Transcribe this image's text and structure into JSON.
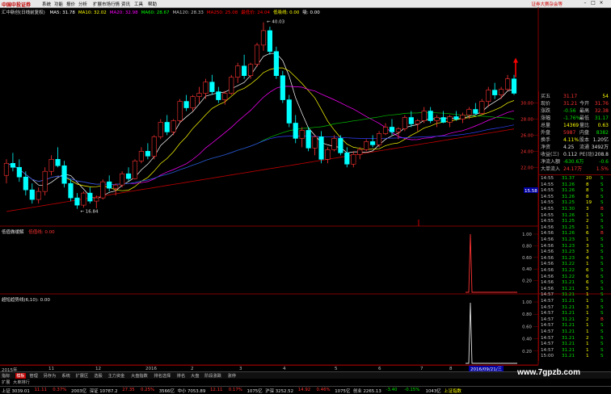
{
  "menubar": {
    "logo": "中国中投证券",
    "items": [
      "系统",
      "功能",
      "报价",
      "分析",
      "扩展市场行情",
      "资讯",
      "工具",
      "帮助"
    ],
    "promo": "证券大赛杂会等"
  },
  "main_chart": {
    "title_prefix": "汇中新创(日线前复权)",
    "indicators": [
      {
        "text": "MA5: 31.78",
        "color": "#ffffff"
      },
      {
        "text": "MA10: 32.02",
        "color": "#ffff00"
      },
      {
        "text": "MA20: 32.98",
        "color": "#ff00ff"
      },
      {
        "text": "MA60: 28.67",
        "color": "#00ff00"
      },
      {
        "text": "MA120: 28.33",
        "color": "#c0c0c0"
      },
      {
        "text": "MA250: 25.08",
        "color": "#ff0000"
      },
      {
        "text": "最低价: 24.04",
        "color": "#ff0000"
      },
      {
        "text": "低吸线: 0.00",
        "color": "#ffff00"
      },
      {
        "text": "吸: 0.00",
        "color": "#ffffff"
      }
    ],
    "y_labels": [
      "30.00",
      "28.00",
      "26.00",
      "24.00",
      "22.00"
    ],
    "high_label": "40.03",
    "low_label": "16.84",
    "cursor_label": "15.58"
  },
  "sub1": {
    "title": "低值做缓解",
    "value": "低值线: 0.00",
    "y_labels": [
      "1.00",
      "0.80",
      "0.60",
      "0.40",
      "0.20"
    ]
  },
  "sub2": {
    "title": "超短趋势线(6,10): 0.00",
    "y_labels": [
      "1.00",
      "0.80",
      "0.60",
      "0.40",
      "0.20"
    ]
  },
  "quote": {
    "rows": [
      {
        "l": "买五",
        "v": "31.17",
        "r": "54",
        "lc": "#c0c0c0",
        "vc": "#ff3232",
        "rc": "#ffff00"
      },
      {
        "l": "现价",
        "v": "31.21",
        "r2l": "今开",
        "r": "31.76",
        "vc": "#ff3232",
        "rc": "#ff3232"
      },
      {
        "l": "涨跌",
        "v": "-0.56",
        "r2l": "最高",
        "r": "32.38",
        "vc": "#00e000",
        "rc": "#ff3232"
      },
      {
        "l": "涨幅",
        "v": "-1.76%",
        "r2l": "最低",
        "r": "31.17",
        "vc": "#00e000",
        "rc": "#00e000"
      },
      {
        "l": "总量",
        "v": "14369",
        "r2l": "量比",
        "r": "0.63",
        "vc": "#ffff00",
        "rc": "#ffff00"
      },
      {
        "l": "外盘",
        "v": "5987",
        "r2l": "内盘",
        "r": "8382",
        "vc": "#ff3232",
        "rc": "#00e000"
      },
      {
        "l": "换手",
        "v": "4.11%",
        "r2l": "股本",
        "r": "1.20亿",
        "vc": "#ffff00",
        "rc": "#e0e0e0"
      },
      {
        "l": "净资",
        "v": "4.25",
        "r2l": "流通",
        "r": "3492万",
        "vc": "#e0e0e0",
        "rc": "#e0e0e0"
      },
      {
        "l": "收益(三)",
        "v": "0.112",
        "r2l": "PE(动)",
        "r": "208.8",
        "vc": "#e0e0e0",
        "rc": "#e0e0e0"
      },
      {
        "l": "净流入额",
        "v": "-630.6万",
        "r": "-0.6",
        "vc": "#00e000",
        "rc": "#00e000"
      },
      {
        "l": "大单流入",
        "v": "24.17万",
        "r": "1.5%",
        "vc": "#ff3232",
        "rc": "#ff3232"
      }
    ],
    "ticks": [
      {
        "t": "14:55",
        "p": "31.37",
        "v": "20",
        "s": "S"
      },
      {
        "t": "14:55",
        "p": "31.26",
        "v": "8",
        "s": "S"
      },
      {
        "t": "14:55",
        "p": "31.26",
        "v": "8",
        "s": "S"
      },
      {
        "t": "14:55",
        "p": "31.26",
        "v": "8",
        "s": "S"
      },
      {
        "t": "14:55",
        "p": "31.25",
        "v": "19",
        "s": "S"
      },
      {
        "t": "14:55",
        "p": "31.30",
        "v": "3",
        "s": "B"
      },
      {
        "t": "14:55",
        "p": "31.26",
        "v": "1",
        "s": "S"
      },
      {
        "t": "14:55",
        "p": "31.25",
        "v": "2",
        "s": "S"
      },
      {
        "t": "14:56",
        "p": "31.25",
        "v": "1",
        "s": "S"
      },
      {
        "t": "14:56",
        "p": "31.26",
        "v": "6",
        "s": "B"
      },
      {
        "t": "14:56",
        "p": "31.23",
        "v": "1",
        "s": "S"
      },
      {
        "t": "14:56",
        "p": "31.23",
        "v": "3",
        "s": "S"
      },
      {
        "t": "14:56",
        "p": "31.23",
        "v": "3",
        "s": "S"
      },
      {
        "t": "14:56",
        "p": "31.23",
        "v": "4",
        "s": "S"
      },
      {
        "t": "14:56",
        "p": "31.22",
        "v": "1",
        "s": "S"
      },
      {
        "t": "14:56",
        "p": "31.22",
        "v": "6",
        "s": "S"
      },
      {
        "t": "14:56",
        "p": "31.22",
        "v": "6",
        "s": "S"
      },
      {
        "t": "14:56",
        "p": "31.21",
        "v": "6",
        "s": "S"
      },
      {
        "t": "14:56",
        "p": "31.21",
        "v": "5",
        "s": "S"
      },
      {
        "t": "14:57",
        "p": "31.21",
        "v": "1",
        "s": "S"
      },
      {
        "t": "14:57",
        "p": "31.21",
        "v": "1",
        "s": "S"
      },
      {
        "t": "14:57",
        "p": "31.21",
        "v": "3",
        "s": "S"
      },
      {
        "t": "14:57",
        "p": "31.21",
        "v": "1",
        "s": "S"
      },
      {
        "t": "14:57",
        "p": "31.21",
        "v": "2",
        "s": "B"
      },
      {
        "t": "14:57",
        "p": "31.21",
        "v": "1",
        "s": "S"
      },
      {
        "t": "14:57",
        "p": "31.21",
        "v": "1",
        "s": "S"
      },
      {
        "t": "14:57",
        "p": "31.21",
        "v": "2",
        "s": "S"
      },
      {
        "t": "14:57",
        "p": "31.21",
        "v": "1",
        "s": "S"
      },
      {
        "t": "14:57",
        "p": "31.21",
        "v": "1",
        "s": "S"
      },
      {
        "t": "15:00",
        "p": "31.21",
        "v": "1",
        "s": "S"
      }
    ]
  },
  "xaxis": {
    "start": "2015年",
    "labels": [
      "11",
      "12",
      "2016",
      "2",
      "3",
      "4",
      "5",
      "6",
      "7",
      "8"
    ],
    "date_badge": "2016/09/21/三"
  },
  "tabs": [
    "指标",
    "模板",
    "管理",
    "另存为",
    "系统",
    "扩展区",
    "选股",
    "主力资金",
    "大盘指数",
    "排名选择",
    "排名",
    "大盘",
    "阶段涨跌",
    "涨停"
  ],
  "tab_active_index": 1,
  "tabs2": [
    "扩展",
    "大单排行"
  ],
  "status": [
    {
      "text": "上证 3039.01",
      "c": "white"
    },
    {
      "text": "11.11",
      "c": "red"
    },
    {
      "text": "0.37%",
      "c": "red"
    },
    {
      "text": "2003亿",
      "c": "white"
    },
    {
      "text": "深证 10787.2",
      "c": "white"
    },
    {
      "text": "27.35",
      "c": "red"
    },
    {
      "text": "0.25%",
      "c": "red"
    },
    {
      "text": "3566亿",
      "c": "white"
    },
    {
      "text": "中小 7053.89",
      "c": "white"
    },
    {
      "text": "12.11",
      "c": "red"
    },
    {
      "text": "0.17%",
      "c": "red"
    },
    {
      "text": "1075亿",
      "c": "white"
    },
    {
      "text": "沪深 3252.52",
      "c": "white"
    },
    {
      "text": "14.92",
      "c": "red"
    },
    {
      "text": "0.46%",
      "c": "red"
    },
    {
      "text": "1075亿",
      "c": "white"
    },
    {
      "text": "创业 2265.13",
      "c": "white"
    },
    {
      "text": "-3.40",
      "c": "green"
    },
    {
      "text": "-0.15%",
      "c": "green"
    },
    {
      "text": "1043亿",
      "c": "white"
    },
    {
      "text": "上证指数",
      "c": "yellow"
    }
  ],
  "watermark": "www.7gpzb.com",
  "colors": {
    "up": "#ff3232",
    "down": "#00ffff",
    "frame": "#800000"
  },
  "chart_data": {
    "type": "candlestick",
    "note_levels": {
      "high": "40.03",
      "low": "16.84"
    },
    "candles": [
      [
        21,
        23,
        20,
        22.5
      ],
      [
        22.5,
        23.8,
        21.5,
        22.0
      ],
      [
        22,
        23,
        20.2,
        20.8
      ],
      [
        20.8,
        21.5,
        18.5,
        19.2
      ],
      [
        19.2,
        20.0,
        17.5,
        18.0
      ],
      [
        18,
        19.5,
        17.5,
        19.0
      ],
      [
        19,
        22,
        18.5,
        21.5
      ],
      [
        21.5,
        23.5,
        21,
        23.0
      ],
      [
        23,
        24.5,
        22,
        22.2
      ],
      [
        22.2,
        22.8,
        19.5,
        20.0
      ],
      [
        20,
        20.5,
        17.8,
        18.2
      ],
      [
        18.2,
        18.8,
        16.84,
        17.3
      ],
      [
        17.3,
        19,
        17,
        18.8
      ],
      [
        18.8,
        19.5,
        17.5,
        17.8
      ],
      [
        17.8,
        18.5,
        16.9,
        18.2
      ],
      [
        18.2,
        20.5,
        18,
        20.2
      ],
      [
        20.2,
        21,
        19,
        19.4
      ],
      [
        19.4,
        20,
        18.5,
        19.8
      ],
      [
        19.8,
        21.5,
        19.5,
        21.2
      ],
      [
        21.2,
        22,
        20.3,
        20.6
      ],
      [
        20.6,
        23,
        20.5,
        22.8
      ],
      [
        22.8,
        24.5,
        22.5,
        24.0
      ],
      [
        24,
        25,
        23,
        23.4
      ],
      [
        23.4,
        26,
        23,
        25.8
      ],
      [
        25.8,
        28,
        25.5,
        27.6
      ],
      [
        27.6,
        28.5,
        26,
        26.4
      ],
      [
        26.4,
        28,
        26,
        27.8
      ],
      [
        27.8,
        30.5,
        27.5,
        30.2
      ],
      [
        30.2,
        31,
        29,
        29.4
      ],
      [
        29.4,
        31,
        29,
        30.8
      ],
      [
        30.8,
        32,
        30,
        31.2
      ],
      [
        31.2,
        33,
        30.5,
        32.6
      ],
      [
        32.6,
        33.5,
        31,
        31.4
      ],
      [
        31.4,
        32,
        30,
        30.4
      ],
      [
        30.4,
        31.5,
        29.8,
        31.2
      ],
      [
        31.2,
        33.5,
        31,
        33.2
      ],
      [
        33.2,
        35,
        32.5,
        34.6
      ],
      [
        34.6,
        36,
        33,
        33.4
      ],
      [
        33.4,
        35,
        33,
        34.8
      ],
      [
        34.8,
        37.5,
        34.5,
        37.2
      ],
      [
        37.2,
        40.03,
        36.5,
        39.0
      ],
      [
        39,
        39.5,
        36,
        36.4
      ],
      [
        36.4,
        37,
        33,
        33.4
      ],
      [
        33.4,
        34,
        30,
        30.4
      ],
      [
        30.4,
        31,
        27,
        27.5
      ],
      [
        27.5,
        28.5,
        25,
        25.6
      ],
      [
        25.6,
        27,
        24.5,
        26.6
      ],
      [
        26.6,
        27,
        24,
        24.4
      ],
      [
        24.4,
        26,
        23.5,
        25.8
      ],
      [
        25.8,
        26.5,
        22.5,
        23.0
      ],
      [
        23,
        24.5,
        22.5,
        24.2
      ],
      [
        24.2,
        26,
        24,
        25.6
      ],
      [
        25.6,
        26,
        23.5,
        23.8
      ],
      [
        23.8,
        24.5,
        22,
        22.4
      ],
      [
        22.4,
        24,
        22,
        23.6
      ],
      [
        23.6,
        24.5,
        23,
        24.2
      ],
      [
        24.2,
        25.5,
        24,
        25.2
      ],
      [
        25.2,
        26,
        24.5,
        24.8
      ],
      [
        24.8,
        26.5,
        24.5,
        26.2
      ],
      [
        26.2,
        27.5,
        26,
        27.0
      ],
      [
        27,
        28,
        26,
        26.4
      ],
      [
        26.4,
        27,
        25.5,
        26.8
      ],
      [
        26.8,
        28.5,
        26.5,
        28.2
      ],
      [
        28.2,
        29,
        27,
        27.4
      ],
      [
        27.4,
        28,
        26.5,
        27.8
      ],
      [
        27.8,
        29.5,
        27.5,
        29.0
      ],
      [
        29,
        29.5,
        27.5,
        27.8
      ],
      [
        27.8,
        28.5,
        27,
        28.2
      ],
      [
        28.2,
        29,
        27.5,
        27.6
      ],
      [
        27.6,
        28.5,
        27,
        28.3
      ],
      [
        28.3,
        29,
        27.8,
        28.0
      ],
      [
        28,
        28.8,
        27.5,
        28.5
      ],
      [
        28.5,
        29.5,
        28,
        29.2
      ],
      [
        29.2,
        30,
        28.5,
        28.7
      ],
      [
        28.7,
        30.5,
        28.5,
        30.2
      ],
      [
        30.2,
        32,
        29.5,
        31.6
      ],
      [
        31.6,
        32.5,
        30.5,
        31.0
      ],
      [
        31,
        32,
        30.5,
        31.7
      ],
      [
        31.7,
        33.5,
        31.5,
        33.0
      ],
      [
        33,
        33.5,
        31,
        31.21
      ]
    ]
  }
}
